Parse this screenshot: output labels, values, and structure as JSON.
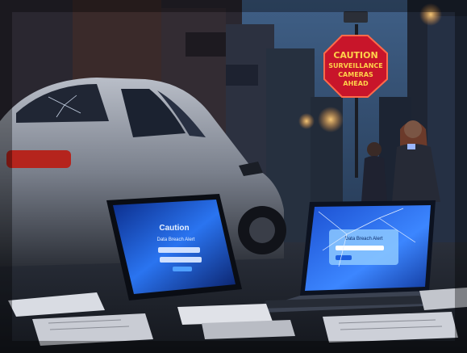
{
  "sign": {
    "line1": "CAUTION",
    "line2": "SURVEILLANCE",
    "line3": "CAMERAS",
    "line4": "AHEAD"
  },
  "left_laptop": {
    "title": "Caution",
    "subtitle": "Data Breach Alert"
  },
  "right_laptop": {
    "title": "Data Breach Alert"
  },
  "colors": {
    "sky": "#2f4a6b",
    "sign_red": "#c8152a",
    "neon_yellow": "#ffd24a",
    "screen_blue": "#1e63e0",
    "car_silver": "#8a8f99"
  }
}
